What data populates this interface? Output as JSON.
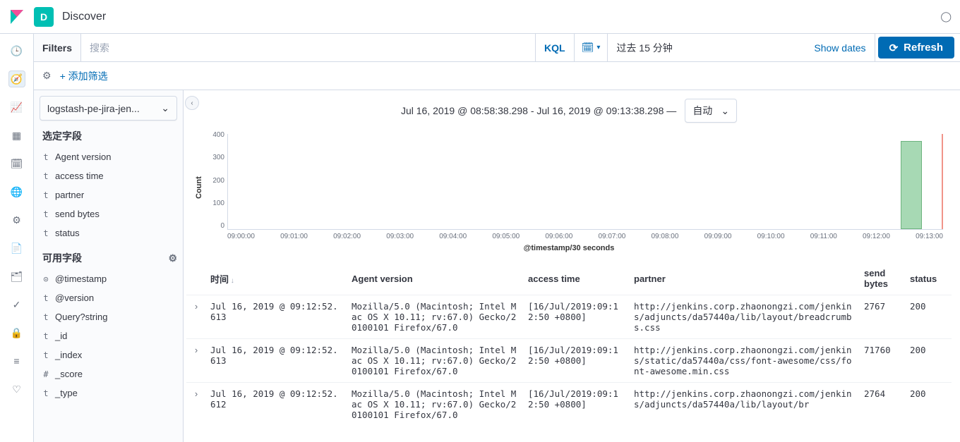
{
  "header": {
    "badge": "D",
    "title": "Discover"
  },
  "query": {
    "filters_label": "Filters",
    "search_placeholder": "搜索",
    "kql_label": "KQL",
    "date_text": "过去 15 分钟",
    "show_dates": "Show dates",
    "refresh": "Refresh",
    "add_filter": "+ 添加筛选"
  },
  "sidebar": {
    "index_pattern": "logstash-pe-jira-jen...",
    "selected_heading": "选定字段",
    "available_heading": "可用字段",
    "selected": [
      {
        "type": "t",
        "name": "Agent version"
      },
      {
        "type": "t",
        "name": "access time"
      },
      {
        "type": "t",
        "name": "partner"
      },
      {
        "type": "t",
        "name": "send bytes"
      },
      {
        "type": "t",
        "name": "status"
      }
    ],
    "available": [
      {
        "type": "⊙",
        "name": "@timestamp"
      },
      {
        "type": "t",
        "name": "@version"
      },
      {
        "type": "t",
        "name": "Query?string"
      },
      {
        "type": "t",
        "name": "_id"
      },
      {
        "type": "t",
        "name": "_index"
      },
      {
        "type": "#",
        "name": "_score"
      },
      {
        "type": "t",
        "name": "_type"
      }
    ]
  },
  "chart": {
    "range": "Jul 16, 2019 @ 08:58:38.298 - Jul 16, 2019 @ 09:13:38.298 —",
    "interval": "自动",
    "y_label": "Count",
    "x_label": "@timestamp/30 seconds",
    "y_ticks": [
      "400",
      "300",
      "200",
      "100",
      "0"
    ],
    "x_ticks": [
      "09:00:00",
      "09:01:00",
      "09:02:00",
      "09:03:00",
      "09:04:00",
      "09:05:00",
      "09:06:00",
      "09:07:00",
      "09:08:00",
      "09:09:00",
      "09:10:00",
      "09:11:00",
      "09:12:00",
      "09:13:00"
    ]
  },
  "chart_data": {
    "type": "bar",
    "title": "",
    "xlabel": "@timestamp/30 seconds",
    "ylabel": "Count",
    "ylim": [
      0,
      400
    ],
    "categories": [
      "09:12:30"
    ],
    "values": [
      370
    ]
  },
  "table": {
    "columns": [
      "时间",
      "Agent version",
      "access time",
      "partner",
      "send bytes",
      "status"
    ],
    "rows": [
      {
        "time": "Jul 16, 2019 @ 09:12:52.613",
        "agent": "Mozilla/5.0 (Macintosh; Intel Mac OS X 10.11; rv:67.0) Gecko/20100101 Firefox/67.0",
        "access": "[16/Jul/2019:09:12:50 +0800]",
        "partner": "http://jenkins.corp.zhaonongzi.com/jenkins/adjuncts/da57440a/lib/layout/breadcrumbs.css",
        "bytes": "2767",
        "status": "200"
      },
      {
        "time": "Jul 16, 2019 @ 09:12:52.613",
        "agent": "Mozilla/5.0 (Macintosh; Intel Mac OS X 10.11; rv:67.0) Gecko/20100101 Firefox/67.0",
        "access": "[16/Jul/2019:09:12:50 +0800]",
        "partner": "http://jenkins.corp.zhaonongzi.com/jenkins/static/da57440a/css/font-awesome/css/font-awesome.min.css",
        "bytes": "71760",
        "status": "200"
      },
      {
        "time": "Jul 16, 2019 @ 09:12:52.612",
        "agent": "Mozilla/5.0 (Macintosh; Intel Mac OS X 10.11; rv:67.0) Gecko/20100101 Firefox/67.0",
        "access": "[16/Jul/2019:09:12:50 +0800]",
        "partner": "http://jenkins.corp.zhaonongzi.com/jenkins/adjuncts/da57440a/lib/layout/br",
        "bytes": "2764",
        "status": "200"
      }
    ]
  }
}
